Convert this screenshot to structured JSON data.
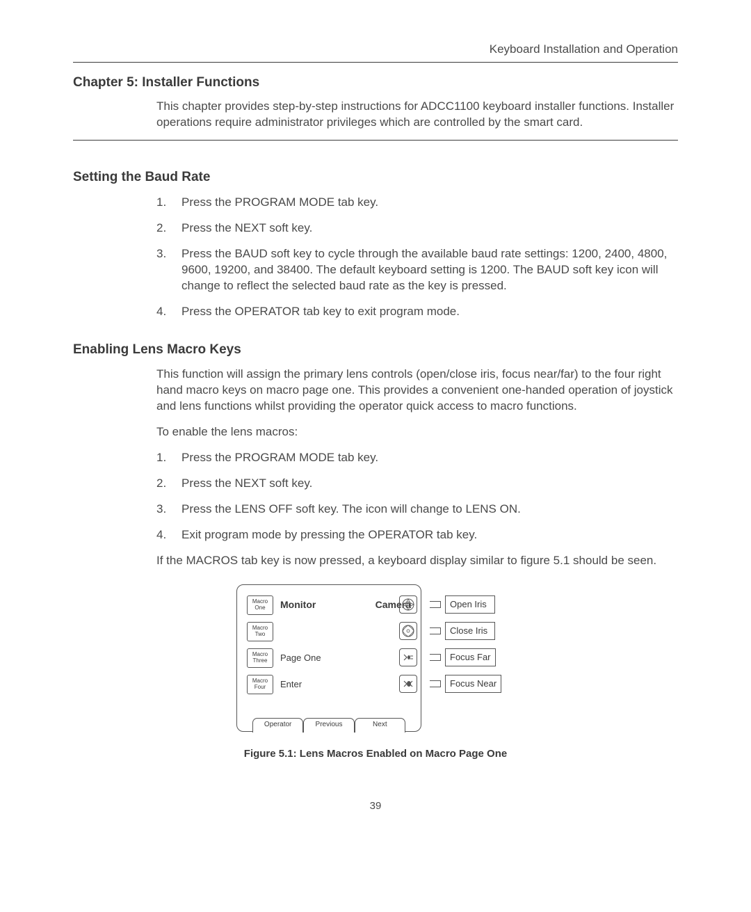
{
  "running_header": "Keyboard Installation and Operation",
  "chapter": {
    "title": "Chapter 5: Installer Functions",
    "intro": "This chapter provides step-by-step instructions for ADCC1100 keyboard installer functions. Installer operations require administrator privileges which are controlled by the smart card."
  },
  "section1": {
    "title": "Setting the Baud Rate",
    "steps": [
      "Press the PROGRAM MODE tab key.",
      "Press the NEXT soft key.",
      "Press the BAUD soft key to cycle through the available baud rate settings: 1200, 2400, 4800, 9600, 19200, and 38400. The default keyboard setting is 1200. The BAUD soft key icon will change to reflect the selected baud rate as the key is pressed.",
      "Press the OPERATOR tab key to exit program mode."
    ]
  },
  "section2": {
    "title": "Enabling Lens Macro Keys",
    "intro": "This function will assign the primary lens controls (open/close iris, focus near/far) to the four right hand macro keys on macro page one. This provides a convenient one-handed operation of joystick and lens functions whilst providing the operator quick access to macro functions.",
    "lead": "To enable the lens macros:",
    "steps": [
      "Press the PROGRAM MODE tab key.",
      "Press the NEXT soft key.",
      "Press the LENS OFF soft key. The icon will change to LENS ON.",
      "Exit program mode by pressing the OPERATOR tab key."
    ],
    "outro": "If the MACROS tab key is now pressed, a keyboard display similar to figure 5.1 should be seen."
  },
  "figure": {
    "macro_buttons": [
      "Macro\nOne",
      "Macro\nTwo",
      "Macro\nThree",
      "Macro\nFour"
    ],
    "row_labels": {
      "monitor": "Monitor",
      "camera": "Camera",
      "page_one": "Page One",
      "enter": "Enter"
    },
    "tabs": [
      "Operator",
      "Previous",
      "Next"
    ],
    "right_labels": [
      "Open Iris",
      "Close Iris",
      "Focus Far",
      "Focus Near"
    ],
    "caption": "Figure 5.1: Lens Macros Enabled on Macro Page One"
  },
  "page_number": "39"
}
